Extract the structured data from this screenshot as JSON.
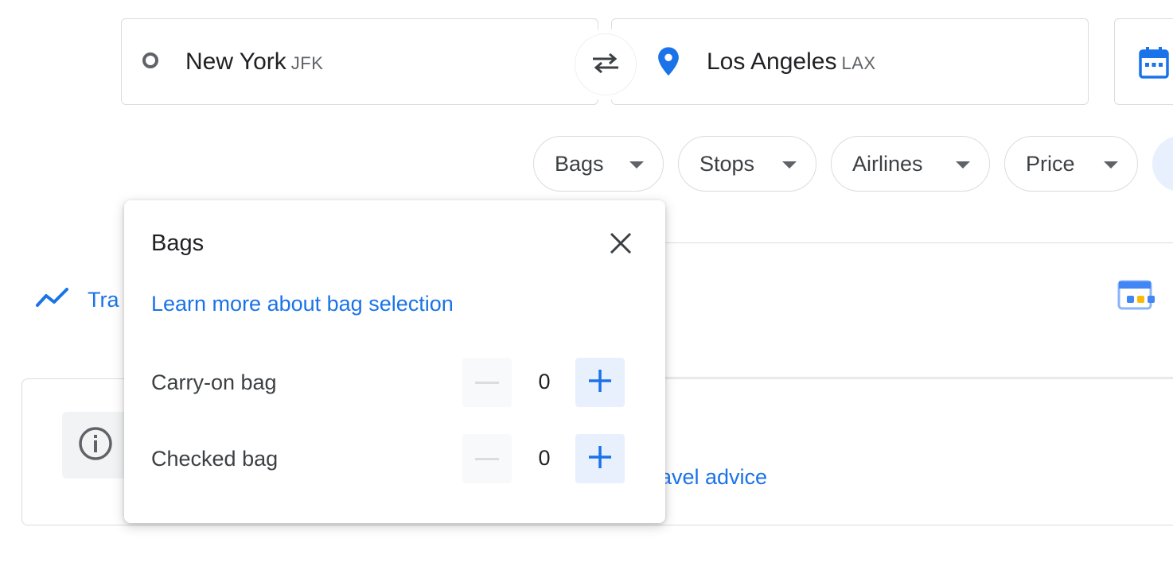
{
  "search": {
    "origin": {
      "city": "New York",
      "code": "JFK"
    },
    "destination": {
      "city": "Los Angeles",
      "code": "LAX"
    }
  },
  "filters": {
    "chips": [
      {
        "label": "Bags"
      },
      {
        "label": "Stops"
      },
      {
        "label": "Airlines"
      },
      {
        "label": "Price"
      }
    ]
  },
  "track_prices": {
    "label_partial": "Tra"
  },
  "advice": {
    "link_partial": "ravel advice"
  },
  "bags_popover": {
    "title": "Bags",
    "learn_more": "Learn more about bag selection",
    "rows": [
      {
        "label": "Carry-on bag",
        "count": "0"
      },
      {
        "label": "Checked bag",
        "count": "0"
      }
    ]
  },
  "colors": {
    "accent": "#1a73e8",
    "text": "#3c4043",
    "border": "#dadce0"
  }
}
